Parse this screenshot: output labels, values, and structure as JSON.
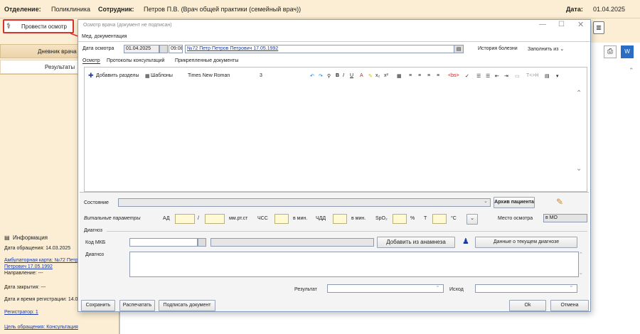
{
  "header": {
    "dept_label": "Отделение:",
    "dept_value": "Поликлиника",
    "employee_label": "Сотрудник:",
    "employee_value": "Петров П.В. (Врач общей практики (семейный врач))",
    "date_label": "Дата:",
    "date_value": "01.04.2025"
  },
  "main_toolbar": {
    "provesti": "Провести осмотр"
  },
  "left": {
    "diary": "Дневник врача",
    "results": "Результаты",
    "info_title": "Информация",
    "date_appeal": "Дата обращения: 14.03.2025",
    "amb_card_1": "Амбулаторная карта: №72 Петр",
    "amb_card_2": "Петрович 17.05.1992",
    "direction": "Направление: ---",
    "date_close": "Дата закрытия: ---",
    "reg_datetime": "Дата и время регистрации: 14.0",
    "registrar": "Регистратор: 1",
    "purpose": "Цель обращения: Консультация"
  },
  "dialog": {
    "title": "Осмотр врача (документ не подписан)",
    "menu": "Мед. документация",
    "date_label": "Дата осмотра",
    "date_value": "01.04.2025",
    "time_value": "09:08",
    "patient_link": "№72 Петр Петров Петрович 17.05.1992",
    "history": "История болезни",
    "fill_from": "Заполнить из",
    "tabs": [
      "Осмотр",
      "Протоколы консультаций",
      "Прикрепленные документы"
    ],
    "toolbar": {
      "add_sections": "Добавить разделы",
      "templates": "Шаблоны",
      "font": "Times New Roman",
      "size": "3",
      "tags": "<bs>",
      "tgh": "T<>H"
    },
    "state_label": "Состояние",
    "archive": "Архив пациента",
    "vitals_label": "Витальные параметры",
    "ad": "АД",
    "slash": "/",
    "mmhg": "мм.рт.ст",
    "hss": "ЧСС",
    "per_min1": "в мин.",
    "chdd": "ЧДД",
    "per_min2": "в мин.",
    "spo2": "SpO₂",
    "pct": "%",
    "t": "Т",
    "deg": "°С",
    "place_label": "Место осмотра",
    "place_value": "в МО",
    "diag_group": "Диагноз",
    "mkb_label": "Код МКБ",
    "add_anamnesis": "Добавить из анамнеза",
    "current_diag": "Данные о текущем диагнозе",
    "diag_label": "Диагноз",
    "result_label": "Результат",
    "outcome_label": "Исход",
    "save": "Сохранить",
    "print": "Распечатать",
    "sign": "Подписать документ",
    "ok": "Ok",
    "cancel": "Отмена"
  },
  "colors": {
    "accent_red": "#d9342b",
    "panel": "#fbeed4",
    "link": "#1a3aa6",
    "vital_fill": "#fff9d4"
  }
}
